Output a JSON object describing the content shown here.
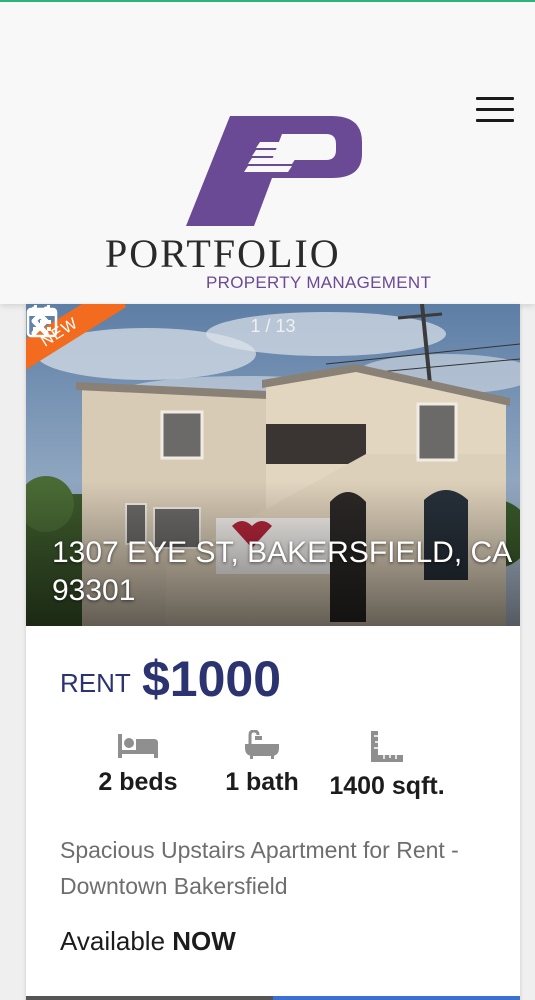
{
  "header": {
    "logo_word": "PORTFOLIO",
    "logo_subtitle": "PROPERTY MANAGEMENT",
    "menu_icon": "hamburger-menu-icon",
    "brand_color": "#6b4a95"
  },
  "listing": {
    "badge": "NEW",
    "photo_counter": "1 / 13",
    "address": "1307 EYE ST, BAKERSFIELD, CA 93301",
    "rent_label": "RENT",
    "rent_amount": "$1000",
    "features": [
      {
        "icon": "bed-icon",
        "label": "2 beds"
      },
      {
        "icon": "bathtub-icon",
        "label": "1 bath"
      },
      {
        "icon": "ruler-icon",
        "label": "1400 sqft."
      }
    ],
    "description": "Spacious Upstairs Apartment for Rent - Downtown Bakersfield",
    "availability_prefix": "Available",
    "availability_status": "NOW",
    "colors": {
      "badge": "#f36b1f",
      "rent": "#2b3470"
    }
  }
}
